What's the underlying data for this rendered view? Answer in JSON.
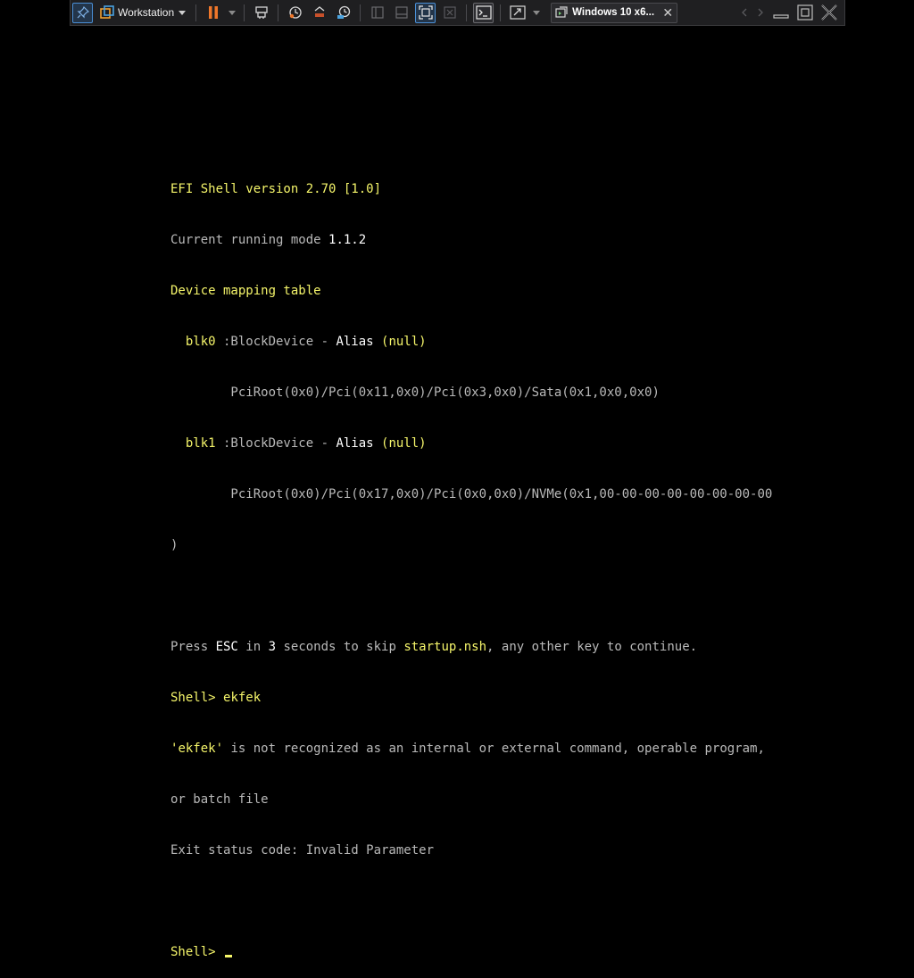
{
  "toolbar": {
    "product_label": "Workstation",
    "vm_tab_label": "Windows 10 x6...",
    "vm_tab_close": "✕",
    "accent": "#4a8fd6",
    "pause_color": "#f0772a"
  },
  "console": {
    "line1": "EFI Shell version 2.70 [1.0]",
    "line2_a": "Current running mode ",
    "line2_b": "1.1.2",
    "line3": "Device mapping table",
    "blk0_name": "  blk0",
    "blk0_type": " :BlockDevice - ",
    "blk0_alias": "Alias",
    "blk0_null": " (null)",
    "blk0_path": "        PciRoot(0x0)/Pci(0x11,0x0)/Pci(0x3,0x0)/Sata(0x1,0x0,0x0)",
    "blk1_name": "  blk1",
    "blk1_type": " :BlockDevice - ",
    "blk1_alias": "Alias",
    "blk1_null": " (null)",
    "blk1_path": "        PciRoot(0x0)/Pci(0x17,0x0)/Pci(0x0,0x0)/NVMe(0x1,00-00-00-00-00-00-00-00",
    "close_paren": ")",
    "press_a": "Press ",
    "press_esc": "ESC",
    "press_b": " in ",
    "press_n": "3",
    "press_c": " seconds to skip ",
    "press_file": "startup.nsh",
    "press_d": ", any other key to continue.",
    "cmd_prompt": "Shell> ",
    "cmd_text": "ekfek",
    "err_q1": "'",
    "err_word": "ekfek",
    "err_q2": "'",
    "err_rest": " is not recognized as an internal or external command, operable program,",
    "err_line2": "or batch file",
    "exit_line": "Exit status code: Invalid Parameter",
    "final_prompt": "Shell> ",
    "text_color": "#b9b9b9",
    "highlight_color": "#f5f56a"
  }
}
